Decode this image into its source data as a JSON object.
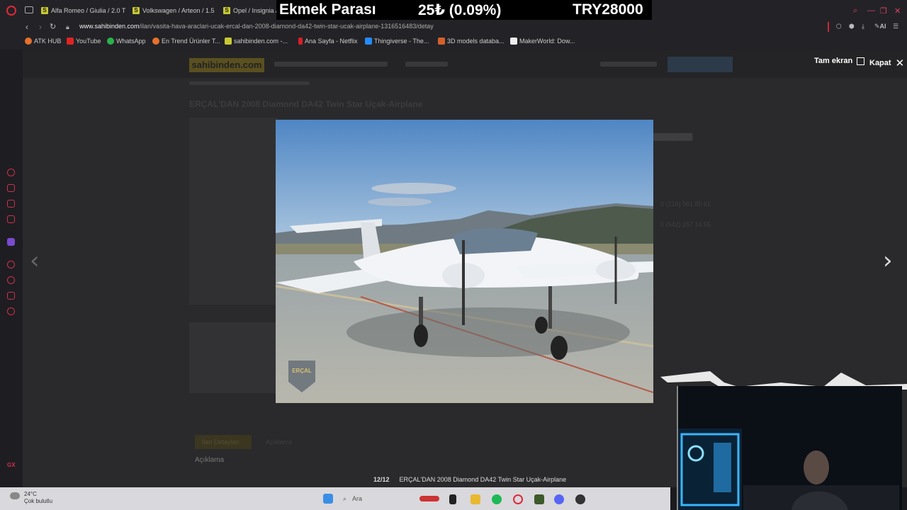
{
  "overlay": {
    "label": "Ekmek Parası",
    "change": "25₺ (0.09%)",
    "price": "TRY28000"
  },
  "tabs": [
    {
      "label": "Alfa Romeo / Giulia / 2.0 T"
    },
    {
      "label": "Volkswagen / Arteon / 1.5"
    },
    {
      "label": "Opel / Insignia /"
    }
  ],
  "address": {
    "domain": "www.sahibinden.com",
    "path": "/ilan/vasita-hava-araclari-ucak-ercal-dan-2008-diamond-da42-twin-star-ucak-airplane-1316516483/detay"
  },
  "bookmarks": [
    {
      "label": "ATK HUB",
      "color": "#e8712b"
    },
    {
      "label": "YouTube",
      "color": "#e02424"
    },
    {
      "label": "WhatsApp",
      "color": "#2bb24c"
    },
    {
      "label": "En Trend Ürünler T...",
      "color": "#e8712b"
    },
    {
      "label": "sahibinden.com -...",
      "color": "#c8c833"
    },
    {
      "label": "Ana Sayfa - Netflix",
      "color": "#d81f26"
    },
    {
      "label": "Thingiverse - The...",
      "color": "#248bfb"
    },
    {
      "label": "3D models databa...",
      "color": "#d35f2c"
    },
    {
      "label": "MakerWorld: Dow...",
      "color": "#eeeeee"
    }
  ],
  "page": {
    "logo": "sahibinden.com",
    "listing_title": "ERÇAL'DAN 2008 Diamond DA42 Twin Star Uçak-Airplane",
    "phone1": "0 (216) 561 85 61",
    "phone2": "0 (542) 257 14 55",
    "tab_info": "İlan Detayları",
    "tab_desc": "Açıklama",
    "section": "Açıklama"
  },
  "lightbox": {
    "fullscreen_label": "Tam ekran",
    "close_label": "Kapat",
    "counter": "12/12",
    "caption": "ERÇAL'DAN 2008 Diamond DA42 Twin Star Uçak-Airplane",
    "watermark": "ERÇAL"
  },
  "taskbar": {
    "temperature": "24°C",
    "weather": "Çok bulutlu",
    "search_placeholder": "Ara"
  },
  "colors": {
    "accent": "#e0283a",
    "brand": "#ffe800",
    "page_dim": "#2a2a2c"
  }
}
